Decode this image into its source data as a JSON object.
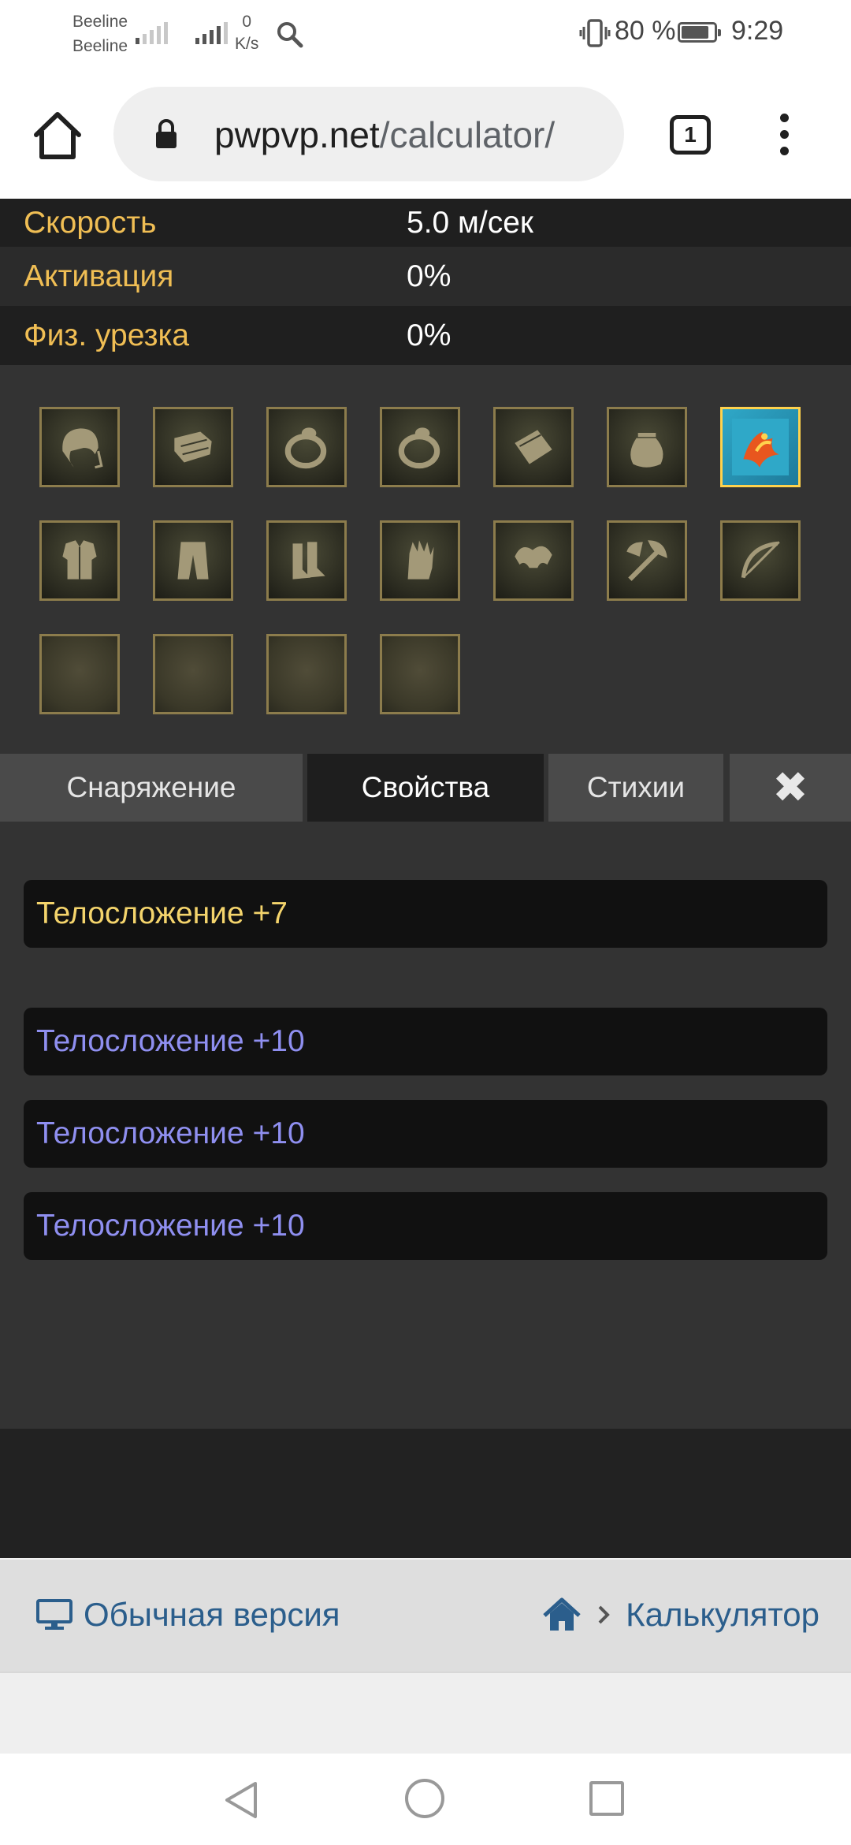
{
  "status_bar": {
    "carrier_1": "Beeline",
    "carrier_2": "Beeline",
    "speed_value": "0",
    "speed_unit": "K/s",
    "battery_percent": "80 %",
    "time": "9:29"
  },
  "browser": {
    "url_domain": "pwpvp.net",
    "url_path": "/calculator/",
    "tab_count": "1"
  },
  "stats": [
    {
      "label": "Скорость",
      "value": "5.0 м/сек"
    },
    {
      "label": "Активация",
      "value": "0%"
    },
    {
      "label": "Физ. урезка",
      "value": "0%"
    }
  ],
  "equipment_slots": [
    {
      "name": "helmet-slot",
      "icon": "helmet-icon",
      "filled": false,
      "active": false
    },
    {
      "name": "bracers-slot",
      "icon": "bracers-icon",
      "filled": false,
      "active": false
    },
    {
      "name": "ring-slot-1",
      "icon": "ring-icon",
      "filled": false,
      "active": false
    },
    {
      "name": "ring-slot-2",
      "icon": "ring-icon",
      "filled": false,
      "active": false
    },
    {
      "name": "cape-slot",
      "icon": "cape-icon",
      "filled": false,
      "active": false
    },
    {
      "name": "pouch-slot",
      "icon": "pouch-icon",
      "filled": false,
      "active": false
    },
    {
      "name": "fashion-slot",
      "icon": "phoenix-icon",
      "filled": true,
      "active": true
    },
    {
      "name": "armor-slot",
      "icon": "armor-icon",
      "filled": false,
      "active": false
    },
    {
      "name": "pants-slot",
      "icon": "pants-icon",
      "filled": false,
      "active": false
    },
    {
      "name": "boots-slot",
      "icon": "boots-icon",
      "filled": false,
      "active": false
    },
    {
      "name": "gloves-slot",
      "icon": "gloves-icon",
      "filled": false,
      "active": false
    },
    {
      "name": "shoulders-slot",
      "icon": "shoulders-icon",
      "filled": false,
      "active": false
    },
    {
      "name": "weapon-slot",
      "icon": "axe-icon",
      "filled": false,
      "active": false
    },
    {
      "name": "ranged-slot",
      "icon": "bow-icon",
      "filled": false,
      "active": false
    },
    {
      "name": "extra-slot-1",
      "icon": "",
      "filled": false,
      "active": false
    },
    {
      "name": "extra-slot-2",
      "icon": "",
      "filled": false,
      "active": false
    },
    {
      "name": "extra-slot-3",
      "icon": "",
      "filled": false,
      "active": false
    },
    {
      "name": "extra-slot-4",
      "icon": "",
      "filled": false,
      "active": false
    }
  ],
  "tabs": [
    {
      "label": "Снаряжение",
      "active": false
    },
    {
      "label": "Свойства",
      "active": true
    },
    {
      "label": "Стихии",
      "active": false
    },
    {
      "label": "✖",
      "active": false
    }
  ],
  "properties": [
    {
      "text": "Телосложение +7",
      "color": "#f4d46c"
    },
    {
      "text": "Телосложение +10",
      "color": "#8f8ff0"
    },
    {
      "text": "Телосложение +10",
      "color": "#8f8ff0"
    },
    {
      "text": "Телосложение +10",
      "color": "#8f8ff0"
    }
  ],
  "footer": {
    "desktop_version_label": "Обычная версия",
    "breadcrumb_current": "Калькулятор",
    "link_color": "#2b5e8c"
  },
  "colors": {
    "stat_label": "#f0be54",
    "slot_border": "#8c7c4c",
    "slot_active_border": "#ffd24d"
  }
}
